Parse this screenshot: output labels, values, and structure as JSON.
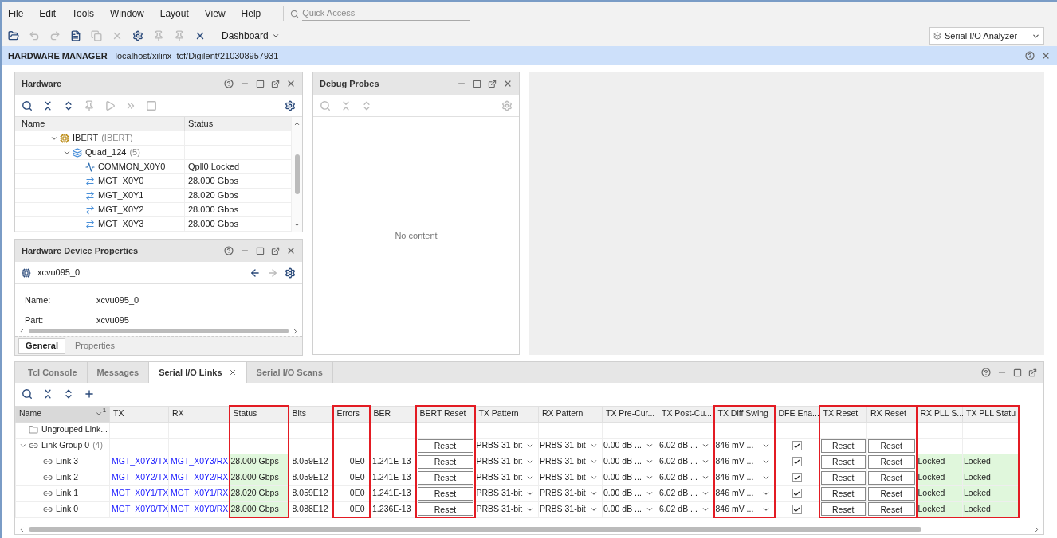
{
  "menu": [
    "File",
    "Edit",
    "Tools",
    "Window",
    "Layout",
    "View",
    "Help"
  ],
  "quick_access": {
    "placeholder": "Quick Access"
  },
  "toolbar": {
    "dashboard": "Dashboard",
    "layout_select": "Serial I/O Analyzer"
  },
  "manager_bar": {
    "title": "HARDWARE MANAGER",
    "path": " - localhost/xilinx_tcf/Digilent/210308957931"
  },
  "hardware": {
    "title": "Hardware",
    "columns": [
      "Name",
      "Status"
    ],
    "tree": [
      {
        "name": "IBERT",
        "suffix": "(IBERT)",
        "kind": "ibert",
        "expanded": true,
        "children": [
          {
            "name": "Quad_124",
            "suffix": "(5)",
            "kind": "quad",
            "expanded": true,
            "children": [
              {
                "name": "COMMON_X0Y0",
                "status": "Qpll0 Locked",
                "kind": "common"
              },
              {
                "name": "MGT_X0Y0",
                "status": "28.000 Gbps",
                "kind": "mgt"
              },
              {
                "name": "MGT_X0Y1",
                "status": "28.020 Gbps",
                "kind": "mgt"
              },
              {
                "name": "MGT_X0Y2",
                "status": "28.000 Gbps",
                "kind": "mgt"
              },
              {
                "name": "MGT_X0Y3",
                "status": "28.000 Gbps",
                "kind": "mgt"
              }
            ]
          }
        ]
      }
    ]
  },
  "properties": {
    "title": "Hardware Device Properties",
    "device": "xcvu095_0",
    "fields": [
      {
        "label": "Name:",
        "value": "xcvu095_0"
      },
      {
        "label": "Part:",
        "value": "xcvu095"
      }
    ],
    "tabs": [
      {
        "label": "General",
        "selected": true
      },
      {
        "label": "Properties",
        "selected": false
      }
    ]
  },
  "debug_probes": {
    "title": "Debug Probes",
    "empty_text": "No content"
  },
  "bottom_tabs": [
    {
      "label": "Tcl Console",
      "selected": false,
      "closable": false
    },
    {
      "label": "Messages",
      "selected": false,
      "closable": false
    },
    {
      "label": "Serial I/O Links",
      "selected": true,
      "closable": true
    },
    {
      "label": "Serial I/O Scans",
      "selected": false,
      "closable": false
    }
  ],
  "links_table": {
    "name_header": "Name",
    "sort_index": "1",
    "columns": [
      {
        "label": "TX",
        "kind": "link",
        "highlighted": false
      },
      {
        "label": "RX",
        "kind": "link",
        "highlighted": false
      },
      {
        "label": "Status",
        "kind": "status",
        "highlighted": true
      },
      {
        "label": "Bits",
        "kind": "number",
        "highlighted": false
      },
      {
        "label": "Errors",
        "kind": "number",
        "highlighted": true
      },
      {
        "label": "BER",
        "kind": "number",
        "highlighted": false
      },
      {
        "label": "BERT Reset",
        "kind": "button",
        "highlighted": true
      },
      {
        "label": "TX Pattern",
        "kind": "dropdown",
        "highlighted": false
      },
      {
        "label": "RX Pattern",
        "kind": "dropdown",
        "highlighted": false
      },
      {
        "label": "TX Pre-Cur...",
        "kind": "dropdown",
        "highlighted": false
      },
      {
        "label": "TX Post-Cu...",
        "kind": "dropdown",
        "highlighted": false
      },
      {
        "label": "TX Diff Swing",
        "kind": "dropdown",
        "highlighted": true
      },
      {
        "label": "DFE Ena...",
        "kind": "checkbox",
        "highlighted": false
      },
      {
        "label": "TX Reset",
        "kind": "button",
        "highlighted": true
      },
      {
        "label": "RX Reset",
        "kind": "button",
        "highlighted": true
      },
      {
        "label": "RX PLL S...",
        "kind": "status",
        "highlighted": true
      },
      {
        "label": "TX PLL Statu",
        "kind": "status",
        "highlighted": true
      }
    ],
    "rows": [
      {
        "name": "Ungrouped Link...",
        "kind": "folder",
        "cells": []
      },
      {
        "name": "Link Group 0",
        "suffix": "(4)",
        "kind": "group",
        "expanded": true,
        "cells": [
          null,
          null,
          null,
          null,
          null,
          null,
          "Reset",
          "PRBS 31-bit",
          "PRBS 31-bit",
          "0.00 dB ...",
          "6.02 dB ...",
          "846 mV ...",
          {
            "checked": true
          },
          "Reset",
          "Reset"
        ],
        "children": [
          {
            "name": "Link 3",
            "kind": "link",
            "cells": [
              "MGT_X0Y3/TX",
              "MGT_X0Y3/RX",
              "28.000 Gbps",
              "8.059E12",
              "0E0",
              "1.241E-13",
              "Reset",
              "PRBS 31-bit",
              "PRBS 31-bit",
              "0.00 dB ...",
              "6.02 dB ...",
              "846 mV ...",
              {
                "checked": true
              },
              "Reset",
              "Reset",
              "Locked",
              "Locked"
            ]
          },
          {
            "name": "Link 2",
            "kind": "link",
            "cells": [
              "MGT_X0Y2/TX",
              "MGT_X0Y2/RX",
              "28.000 Gbps",
              "8.059E12",
              "0E0",
              "1.241E-13",
              "Reset",
              "PRBS 31-bit",
              "PRBS 31-bit",
              "0.00 dB ...",
              "6.02 dB ...",
              "846 mV ...",
              {
                "checked": true
              },
              "Reset",
              "Reset",
              "Locked",
              "Locked"
            ]
          },
          {
            "name": "Link 1",
            "kind": "link",
            "cells": [
              "MGT_X0Y1/TX",
              "MGT_X0Y1/RX",
              "28.020 Gbps",
              "8.059E12",
              "0E0",
              "1.241E-13",
              "Reset",
              "PRBS 31-bit",
              "PRBS 31-bit",
              "0.00 dB ...",
              "6.02 dB ...",
              "846 mV ...",
              {
                "checked": true
              },
              "Reset",
              "Reset",
              "Locked",
              "Locked"
            ]
          },
          {
            "name": "Link 0",
            "kind": "link",
            "cells": [
              "MGT_X0Y0/TX",
              "MGT_X0Y0/RX",
              "28.000 Gbps",
              "8.088E12",
              "0E0",
              "1.236E-13",
              "Reset",
              "PRBS 31-bit",
              "PRBS 31-bit",
              "0.00 dB ...",
              "6.02 dB ...",
              "846 mV ...",
              {
                "checked": true
              },
              "Reset",
              "Reset",
              "Locked",
              "Locked"
            ]
          }
        ]
      }
    ]
  }
}
